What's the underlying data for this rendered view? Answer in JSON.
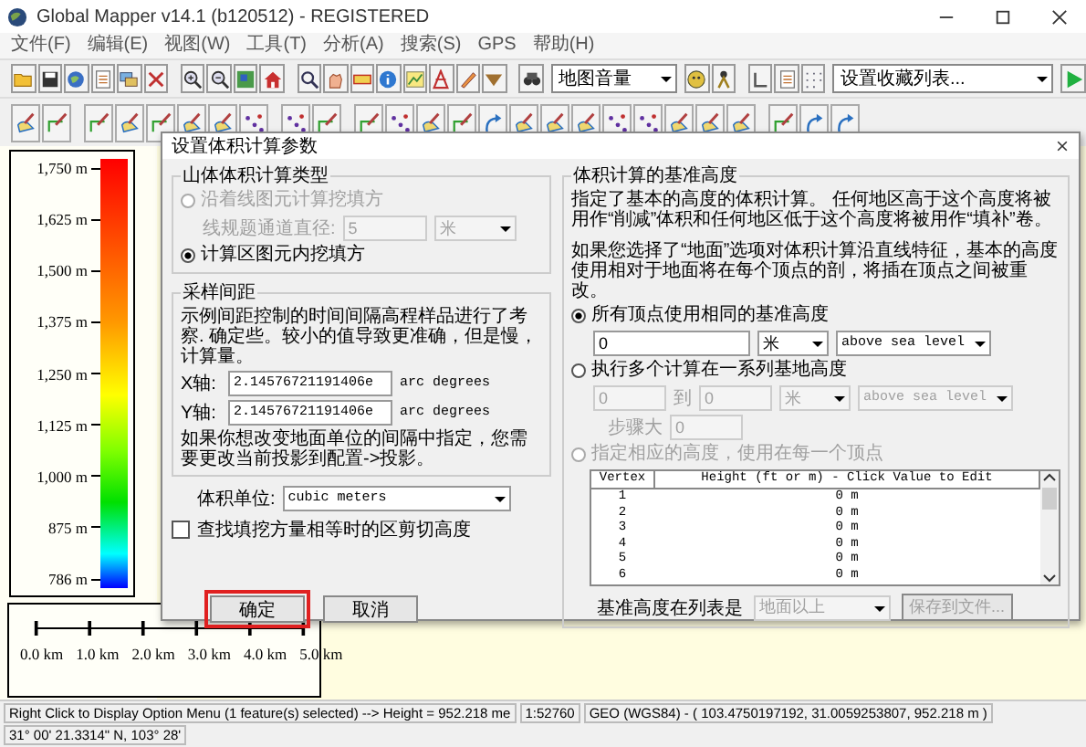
{
  "window": {
    "title": "Global Mapper v14.1 (b120512) - REGISTERED"
  },
  "menu": [
    "文件(F)",
    "编辑(E)",
    "视图(W)",
    "工具(T)",
    "分析(A)",
    "搜索(S)",
    "GPS",
    "帮助(H)"
  ],
  "toolbar": {
    "view_select": "地图音量",
    "favorites_select": "设置收藏列表..."
  },
  "legend": {
    "labels": [
      "1,750 m",
      "1,625 m",
      "1,500 m",
      "1,375 m",
      "1,250 m",
      "1,125 m",
      "1,000 m",
      "875 m",
      "786 m"
    ]
  },
  "scale_bar": {
    "labels": [
      "0.0 km",
      "1.0 km",
      "2.0 km",
      "3.0 km",
      "4.0 km",
      "5.0 km"
    ]
  },
  "dialog": {
    "title": "设置体积计算参数",
    "calc_type": {
      "title": "山体体积计算类型",
      "options": [
        {
          "label": "沿着线图元计算挖填方",
          "selected": false,
          "disabled": true
        },
        {
          "label": "计算区图元内挖填方",
          "selected": true,
          "disabled": false
        }
      ],
      "width_label": "线规题通道直径:",
      "width_value": "5",
      "width_unit": "米",
      "width_disabled": true
    },
    "spacing": {
      "title": "采样间距",
      "description": "示例间距控制的时间间隔高程样品进行了考察. 确定些。较小的值导致更准确，但是慢，计算量。",
      "x_label": "X轴:",
      "x_value": "2.14576721191406e",
      "x_unit": "arc degrees",
      "y_label": "Y轴:",
      "y_value": "2.14576721191406e",
      "y_unit": "arc degrees",
      "note": "如果你想改变地面单位的间隔中指定，您需要更改当前投影到配置->投影。"
    },
    "volume_unit": {
      "label": "体积单位:",
      "value": "cubic meters"
    },
    "equal_cut_fill": {
      "label": "查找填挖方量相等时的区剪切高度",
      "checked": false
    },
    "buttons": [
      {
        "label": "确定",
        "highlighted": true
      },
      {
        "label": "取消",
        "highlighted": false
      }
    ],
    "base_height": {
      "title": "体积计算的基准高度",
      "description": "指定了基本的高度的体积计算。 任何地区高于这个高度将被用作“削减”体积和任何地区低于这个高度将被用作“填补”卷。",
      "note": "如果您选择了“地面”选项对体积计算沿直线特征，基本的高度使用相对于地面将在每个顶点的剖，将插在顶点之间被重改。",
      "options": [
        {
          "label": "所有顶点使用相同的基准高度",
          "selected": true,
          "disabled": false
        },
        {
          "label": "执行多个计算在一系列基地高度",
          "selected": false,
          "disabled": false
        },
        {
          "label": "指定相应的高度，使用在每一个顶点",
          "selected": false,
          "disabled": true
        }
      ],
      "same": {
        "value": "0",
        "unit": "米",
        "reference": "above sea level",
        "disabled": false
      },
      "range": {
        "from": "0",
        "to_label": "到",
        "to": "0",
        "unit": "米",
        "reference": "above sea level",
        "step_label": "步骤大",
        "step": "0",
        "disabled": true
      },
      "table": {
        "columns": [
          "Vertex",
          "Height (ft or m) - Click Value to Edit"
        ],
        "rows": [
          [
            "1",
            "0 m"
          ],
          [
            "2",
            "0 m"
          ],
          [
            "3",
            "0 m"
          ],
          [
            "4",
            "0 m"
          ],
          [
            "5",
            "0 m"
          ],
          [
            "6",
            "0 m"
          ]
        ]
      },
      "list_label": "基准高度在列表是",
      "list_value": "地面以上",
      "save_button": "保存到文件...",
      "list_disabled": true
    }
  },
  "status_bar": [
    "Right Click to Display Option Menu (1 feature(s) selected) --> Height = 952.218 me",
    "1:52760",
    "GEO (WGS84) - ( 103.4750197192, 31.0059253807, 952.218 m )",
    "31° 00' 21.3314\" N, 103° 28'"
  ]
}
